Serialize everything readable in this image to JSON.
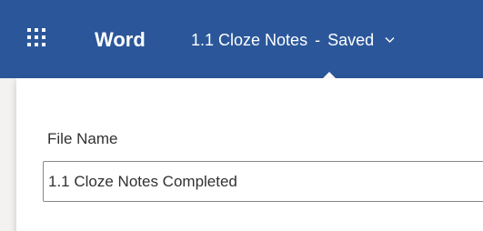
{
  "header": {
    "app_name": "Word",
    "document_title": "1.1 Cloze Notes",
    "separator": "-",
    "save_status": "Saved",
    "brand_color": "#2b579a"
  },
  "rename_panel": {
    "field_label": "File Name",
    "file_name_value": "1.1 Cloze Notes Completed"
  },
  "icons": {
    "app_launcher": "waffle-icon",
    "title_menu": "chevron-down-icon"
  }
}
